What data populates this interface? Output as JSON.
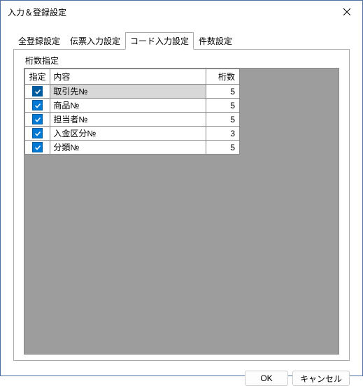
{
  "window": {
    "title": "入力＆登録設定"
  },
  "tabs": {
    "items": [
      {
        "label": "全登録設定",
        "active": false
      },
      {
        "label": "伝票入力設定",
        "active": false
      },
      {
        "label": "コード入力設定",
        "active": true
      },
      {
        "label": "件数設定",
        "active": false
      }
    ]
  },
  "panel": {
    "fieldset_label": "桁数指定",
    "headers": {
      "check": "指定",
      "content": "内容",
      "digits": "桁数"
    },
    "rows": [
      {
        "checked": true,
        "focused": true,
        "selected": true,
        "content": "取引先№",
        "digits": "5"
      },
      {
        "checked": true,
        "focused": false,
        "selected": false,
        "content": "商品№",
        "digits": "5"
      },
      {
        "checked": true,
        "focused": false,
        "selected": false,
        "content": "担当者№",
        "digits": "5"
      },
      {
        "checked": true,
        "focused": false,
        "selected": false,
        "content": "入金区分№",
        "digits": "3"
      },
      {
        "checked": true,
        "focused": false,
        "selected": false,
        "content": "分類№",
        "digits": "5"
      }
    ]
  },
  "footer": {
    "ok": "OK",
    "cancel": "キャンセル"
  }
}
